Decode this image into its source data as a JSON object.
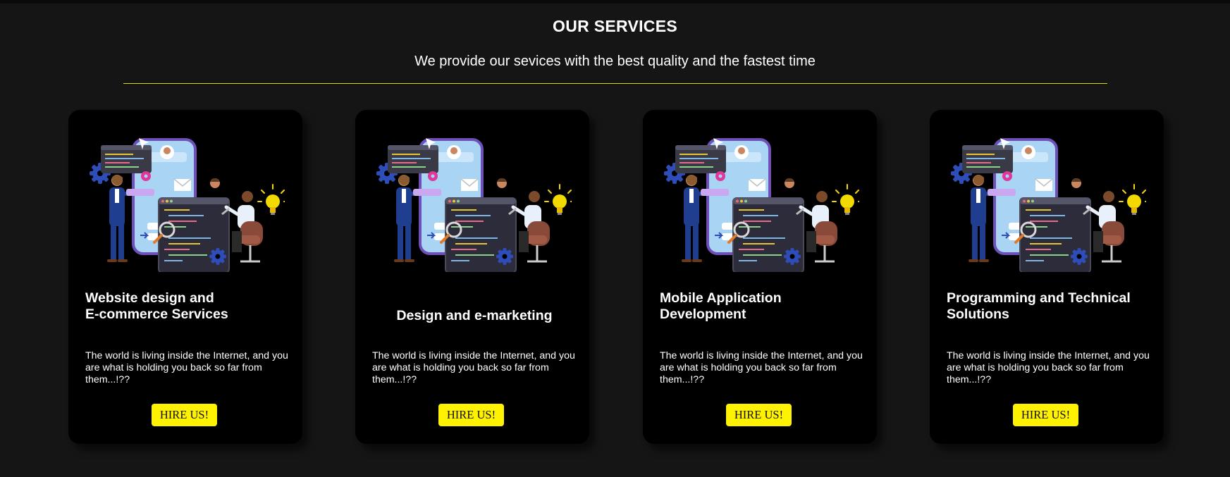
{
  "header": {
    "title": "OUR SERVICES",
    "subtitle": "We provide our sevices with the best quality and the fastest time"
  },
  "colors": {
    "background": "#151515",
    "card": "#000000",
    "accent": "#fff200",
    "divider": "#e3d400"
  },
  "cards": [
    {
      "title_line1": "Website design and",
      "title_line2": "E-commerce Services",
      "description": "The world is living inside the Internet, and you are what is holding you back so far from them...!??",
      "button_label": "HIRE US!",
      "illustration_icon": "developer-team-illustration"
    },
    {
      "title_line1": "Design and e-marketing",
      "title_line2": "",
      "description": "The world is living inside the Internet, and you are what is holding you back so far from them...!??",
      "button_label": "HIRE US!",
      "illustration_icon": "developer-team-illustration"
    },
    {
      "title_line1": "Mobile Application",
      "title_line2": "Development",
      "description": "The world is living inside the Internet, and you are what is holding you back so far from them...!??",
      "button_label": "HIRE US!",
      "illustration_icon": "developer-team-illustration"
    },
    {
      "title_line1": "Programming and Technical",
      "title_line2": "Solutions",
      "description": "The world is living inside the Internet, and you are what is holding you back so far from them...!??",
      "button_label": "HIRE US!",
      "illustration_icon": "developer-team-illustration"
    }
  ]
}
